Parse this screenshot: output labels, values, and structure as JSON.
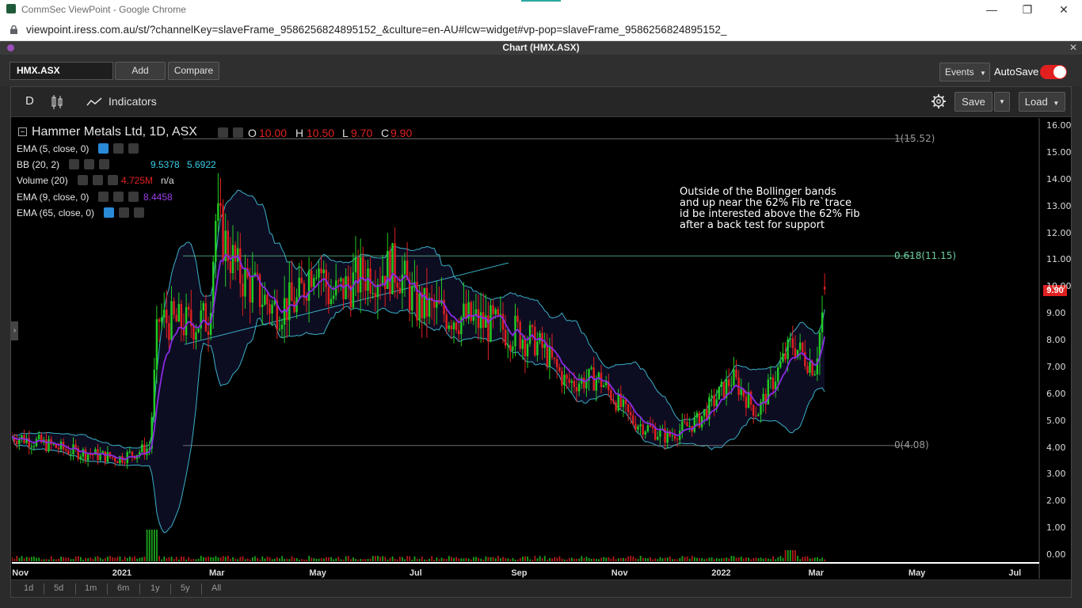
{
  "browser": {
    "tab_title": "CommSec ViewPoint - Google Chrome",
    "url": "viewpoint.iress.com.au/st/?channelKey=slaveFrame_9586256824895152_&culture=en-AU#lcw=widget#vp-pop=slaveFrame_9586256824895152_",
    "minimize": "—",
    "restore": "❐",
    "close": "✕"
  },
  "panel": {
    "title": "Chart (HMX.ASX)",
    "close": "✕"
  },
  "toolbar": {
    "symbol": "HMX.ASX",
    "add_label": "Add",
    "compare_label": "Compare",
    "events_label": "Events",
    "autosave_label": "AutoSave",
    "autosave_on": true
  },
  "chart_toolbar": {
    "interval": "D",
    "indicators_label": "Indicators",
    "save_label": "Save",
    "load_label": "Load"
  },
  "legend": {
    "title": "Hammer Metals Ltd, 1D, ASX",
    "o_label": "O",
    "o": "10.00",
    "h_label": "H",
    "h": "10.50",
    "l_label": "L",
    "l": "9.70",
    "c_label": "C",
    "c": "9.90",
    "indicators": [
      {
        "name": "EMA (5, close, 0)",
        "values": []
      },
      {
        "name": "BB (20, 2)",
        "values": [
          "9.5378",
          "5.6922"
        ]
      },
      {
        "name": "Volume (20)",
        "values": [
          "4.725M",
          "n/a"
        ]
      },
      {
        "name": "EMA (9, close, 0)",
        "values": [
          "8.4458"
        ]
      },
      {
        "name": "EMA (65, close, 0)",
        "values": []
      }
    ]
  },
  "annotation": "Outside of the Bollinger bands\nand up near the 62% Fib re`trace\nid be interested above the 62% Fib\nafter a back test for support",
  "fib_levels": [
    {
      "label": "1(15.52)",
      "value": 15.52
    },
    {
      "label": "0.618(11.15)",
      "value": 11.15
    },
    {
      "label": "0(4.08)",
      "value": 4.08
    }
  ],
  "last_price_tag": "9.90",
  "range_buttons": [
    "1d",
    "5d",
    "1m",
    "6m",
    "1y",
    "5y",
    "All"
  ],
  "colors": {
    "up": "#22cc22",
    "down": "#e02020",
    "bb": "#3ab0c8",
    "ema": "#8a2be2",
    "fib": "#888888",
    "fib_mid": "#5fbf8f"
  },
  "chart_data": {
    "type": "candlestick",
    "title": "Hammer Metals Ltd, 1D, ASX",
    "x_ticks": [
      "Nov",
      "2021",
      "Mar",
      "May",
      "Jul",
      "Sep",
      "Nov",
      "2022",
      "Mar",
      "May",
      "Jul"
    ],
    "y_ticks": [
      "0.00",
      "1.00",
      "2.00",
      "3.00",
      "4.00",
      "5.00",
      "6.00",
      "7.00",
      "8.00",
      "9.00",
      "10.00",
      "11.00",
      "12.00",
      "13.00",
      "14.00",
      "15.00",
      "16.00"
    ],
    "ylim": [
      0,
      16
    ],
    "price_path": [
      [
        "2020-11",
        4.4
      ],
      [
        "2020-12",
        3.9
      ],
      [
        "2021-01",
        3.6
      ],
      [
        "2021-01-20",
        4.0
      ],
      [
        "2021-01-25",
        8.8
      ],
      [
        "2021-02-10",
        8.6
      ],
      [
        "2021-02-25",
        8.8
      ],
      [
        "2021-03-01",
        12.5
      ],
      [
        "2021-03-15",
        10.5
      ],
      [
        "2021-04-05",
        9.2
      ],
      [
        "2021-04-20",
        9.4
      ],
      [
        "2021-05-01",
        11.2
      ],
      [
        "2021-05-10",
        9.6
      ],
      [
        "2021-06-01",
        10.5
      ],
      [
        "2021-06-20",
        10.7
      ],
      [
        "2021-07-01",
        9.3
      ],
      [
        "2021-08-01",
        8.8
      ],
      [
        "2021-09-01",
        8.3
      ],
      [
        "2021-09-15",
        7.8
      ],
      [
        "2021-10-01",
        6.4
      ],
      [
        "2021-10-20",
        6.6
      ],
      [
        "2021-11-10",
        5.0
      ],
      [
        "2021-12-01",
        4.4
      ],
      [
        "2021-12-20",
        5.0
      ],
      [
        "2022-01-10",
        6.6
      ],
      [
        "2022-01-25",
        5.3
      ],
      [
        "2022-02-15",
        7.9
      ],
      [
        "2022-03-01",
        7.0
      ],
      [
        "2022-03-08",
        9.9
      ]
    ],
    "last_close": 9.9,
    "bb_upper_last": 9.5378,
    "bb_lower_last": 5.6922,
    "ema9_last": 8.4458
  }
}
